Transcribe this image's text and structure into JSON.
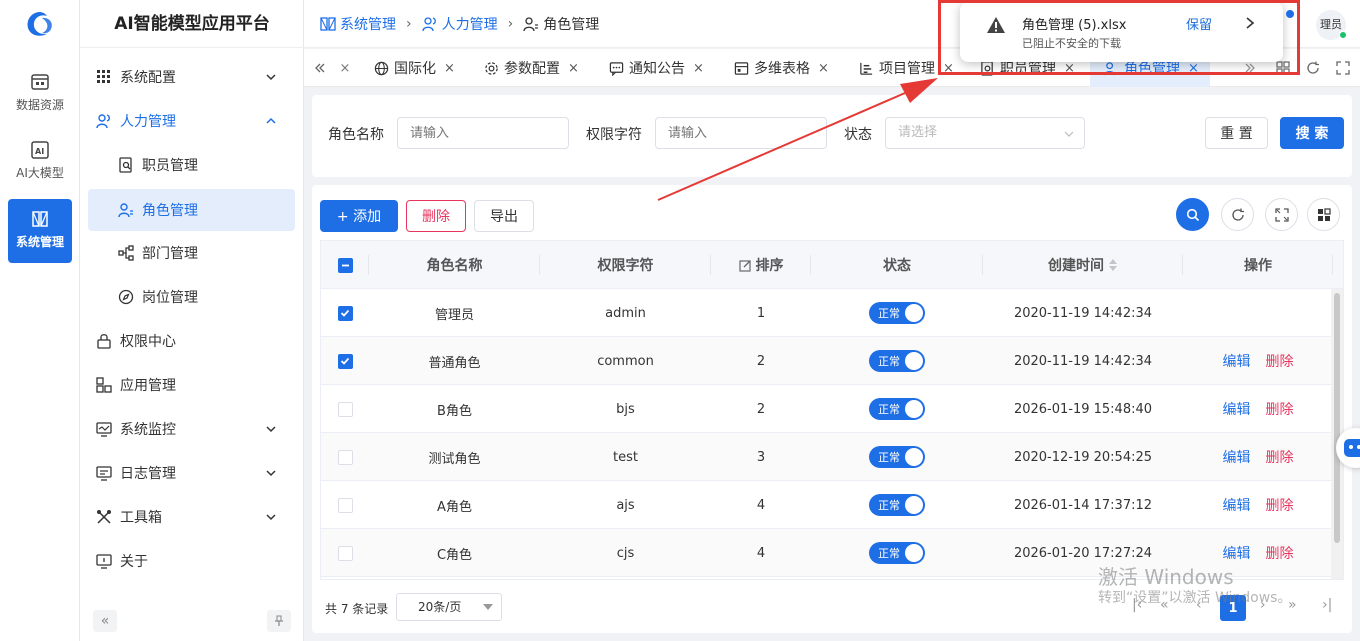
{
  "rail": {
    "items": [
      {
        "label": "数据资源",
        "icon": "data-resource-icon"
      },
      {
        "label": "AI大模型",
        "icon": "ai-model-icon"
      },
      {
        "label": "系统管理",
        "icon": "system-manage-icon"
      }
    ]
  },
  "menu": {
    "title": "AI智能模型应用平台",
    "items": [
      {
        "label": "系统配置"
      },
      {
        "label": "人力管理"
      },
      {
        "label": "职员管理"
      },
      {
        "label": "角色管理"
      },
      {
        "label": "部门管理"
      },
      {
        "label": "岗位管理"
      },
      {
        "label": "权限中心"
      },
      {
        "label": "应用管理"
      },
      {
        "label": "系统监控"
      },
      {
        "label": "日志管理"
      },
      {
        "label": "工具箱"
      },
      {
        "label": "关于"
      }
    ],
    "collapse_glyph": "«"
  },
  "breadcrumb": [
    "系统管理",
    "人力管理",
    "角色管理"
  ],
  "header": {
    "avatar_text": "理员"
  },
  "tabs": [
    {
      "label": "国际化"
    },
    {
      "label": "参数配置"
    },
    {
      "label": "通知公告"
    },
    {
      "label": "多维表格"
    },
    {
      "label": "项目管理"
    },
    {
      "label": "职员管理"
    },
    {
      "label": "角色管理"
    }
  ],
  "search": {
    "role_name_label": "角色名称",
    "role_name_placeholder": "请输入",
    "perm_label": "权限字符",
    "perm_placeholder": "请输入",
    "status_label": "状态",
    "status_placeholder": "请选择",
    "reset_label": "重 置",
    "search_label": "搜 索"
  },
  "toolbar": {
    "add_label": "+ 添加",
    "delete_label": "删除",
    "export_label": "导出"
  },
  "table": {
    "headers": [
      "角色名称",
      "权限字符",
      "排序",
      "状态",
      "创建时间",
      "操作"
    ],
    "rows": [
      {
        "name": "管理员",
        "key": "admin",
        "sort": "1",
        "status": "正常",
        "time": "2020-11-19 14:42:34",
        "checked": true,
        "ops": false
      },
      {
        "name": "普通角色",
        "key": "common",
        "sort": "2",
        "status": "正常",
        "time": "2020-11-19 14:42:34",
        "checked": true,
        "ops": true
      },
      {
        "name": "B角色",
        "key": "bjs",
        "sort": "2",
        "status": "正常",
        "time": "2026-01-19 15:48:40",
        "checked": false,
        "ops": true
      },
      {
        "name": "测试角色",
        "key": "test",
        "sort": "3",
        "status": "正常",
        "time": "2020-12-19 20:54:25",
        "checked": false,
        "ops": true
      },
      {
        "name": "A角色",
        "key": "ajs",
        "sort": "4",
        "status": "正常",
        "time": "2026-01-14 17:37:12",
        "checked": false,
        "ops": true
      },
      {
        "name": "C角色",
        "key": "cjs",
        "sort": "4",
        "status": "正常",
        "time": "2026-01-20 17:27:24",
        "checked": false,
        "ops": true
      }
    ],
    "edit_label": "编辑",
    "delete_label": "删除"
  },
  "pager": {
    "total_text": "共 7 条记录",
    "page_size": "20条/页",
    "current_page": "1"
  },
  "download_popup": {
    "filename": "角色管理 (5).xlsx",
    "message": "已阻止不安全的下载",
    "keep_label": "保留"
  },
  "watermark": {
    "line1": "激活 Windows",
    "line2": "转到“设置”以激活 Windows。"
  },
  "colors": {
    "primary": "#1e6fe6",
    "danger": "#e8355e",
    "annotation": "#e53935"
  }
}
